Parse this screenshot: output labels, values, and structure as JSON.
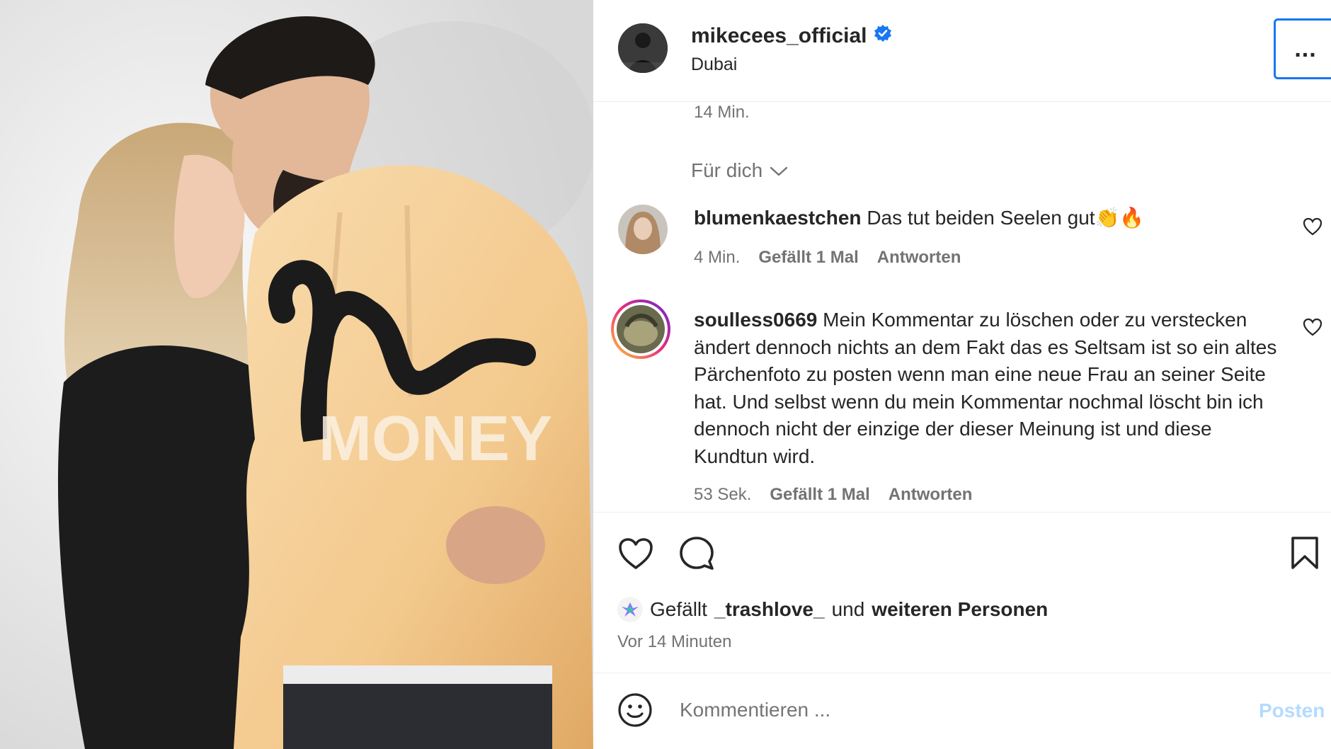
{
  "post": {
    "username": "mikecees_official",
    "location": "Dubai",
    "time": "14 Min.",
    "more_label": "..."
  },
  "comments_sort": "Für dich",
  "comments": [
    {
      "username": "blumenkaestchen",
      "text": "Das tut beiden Seelen gut👏🔥",
      "time": "4 Min.",
      "likes": "Gefällt 1 Mal",
      "reply": "Antworten"
    },
    {
      "username": "soulless0669",
      "text": "Mein Kommentar zu löschen oder zu verstecken ändert dennoch nichts an dem Fakt das es Seltsam ist so ein altes Pärchenfoto zu posten wenn man eine neue Frau an seiner Seite hat. Und selbst wenn du mein Kommentar nochmal löscht bin ich dennoch nicht der einzige der dieser Meinung ist und diese Kundtun wird.",
      "time": "53 Sek.",
      "likes": "Gefällt 1 Mal",
      "reply": "Antworten"
    }
  ],
  "liked_by": {
    "prefix": "Gefällt",
    "user": "_trashlove_",
    "middle": "und",
    "rest": "weiteren Personen"
  },
  "posted_ago": "Vor 14 Minuten",
  "comment_box": {
    "placeholder": "Kommentieren ...",
    "post_label": "Posten"
  },
  "colors": {
    "verified": "#1877f2",
    "story_ring_start": "#f9ce34",
    "story_ring_end": "#ee2a7b",
    "post_disabled": "#b3dbff"
  },
  "icons": [
    "verified-badge-icon",
    "chevron-down-icon",
    "heart-icon",
    "comment-icon",
    "bookmark-icon",
    "emoji-icon"
  ]
}
